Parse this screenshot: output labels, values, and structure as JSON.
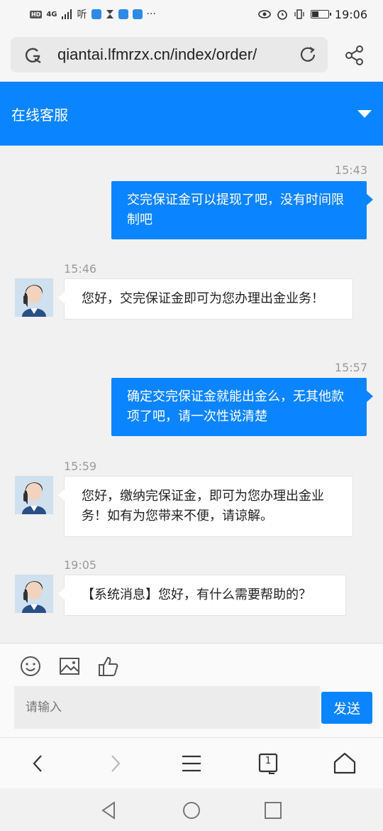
{
  "status_bar": {
    "left_badge": "HD",
    "network": "4G",
    "carrier_icon": "听",
    "more": "···",
    "time": "19:06",
    "battery_level": 0.4
  },
  "browser": {
    "url": "qiantai.lfmrzx.cn/index/order/"
  },
  "header": {
    "title": "在线客服"
  },
  "messages": [
    {
      "side": "out",
      "time": "15:43",
      "text": "交完保证金可以提现了吧，没有时间限制吧"
    },
    {
      "side": "in",
      "time": "15:46",
      "text": "您好，交完保证金即可为您办理出金业务！"
    },
    {
      "side": "out",
      "time": "15:57",
      "text": "确定交完保证金就能出金么，无其他款项了吧，请一次性说清楚"
    },
    {
      "side": "in",
      "time": "15:59",
      "text": "您好，缴纳完保证金，即可为您办理出金业务！如有为您带来不便，请谅解。"
    },
    {
      "side": "in",
      "time": "19:05",
      "text": "【系统消息】您好，有什么需要帮助的？"
    }
  ],
  "composer": {
    "placeholder": "请输入",
    "send_label": "发送"
  },
  "browser_nav": {
    "tab_count": "1"
  },
  "colors": {
    "accent": "#0b84ff",
    "background": "#f1f1f1"
  }
}
